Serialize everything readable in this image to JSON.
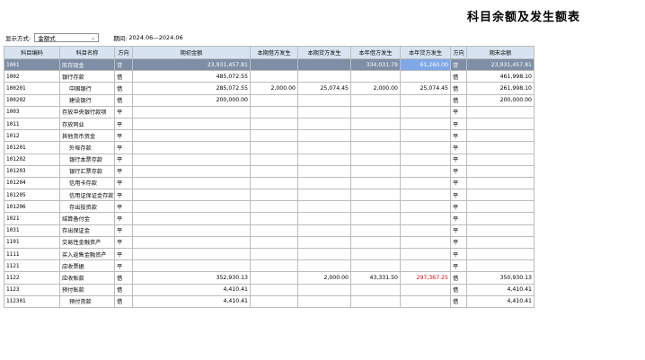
{
  "title": "科目余额及发生额表",
  "toolbar": {
    "display_mode_label": "显示方式:",
    "display_mode_value": "金额式",
    "period_label": "期间:",
    "period_value": "2024.06—2024.06"
  },
  "columns": [
    "科目编码",
    "科目名称",
    "方向",
    "期初金额",
    "本期借方发生",
    "本期贷方发生",
    "本年借方发生",
    "本年贷方发生",
    "方向",
    "期末余额"
  ],
  "rows": [
    {
      "code": "1001",
      "name": "库存现金",
      "indent": 0,
      "dir1": "贷",
      "opening": "23,931,457.81",
      "cur_debit": "",
      "cur_credit": "",
      "year_debit": "334,031.79",
      "year_credit": "61,260.00",
      "dir2": "贷",
      "closing": "23,931,457.81"
    },
    {
      "code": "1002",
      "name": "银行存款",
      "indent": 0,
      "dir1": "借",
      "opening": "485,072.55",
      "cur_debit": "",
      "cur_credit": "",
      "year_debit": "",
      "year_credit": "",
      "dir2": "借",
      "closing": "461,998.10"
    },
    {
      "code": "100201",
      "name": "中国银行",
      "indent": 1,
      "dir1": "借",
      "opening": "285,072.55",
      "cur_debit": "2,000.00",
      "cur_credit": "25,074.45",
      "year_debit": "2,000.00",
      "year_credit": "25,074.45",
      "dir2": "借",
      "closing": "261,998.10"
    },
    {
      "code": "100202",
      "name": "建设银行",
      "indent": 1,
      "dir1": "借",
      "opening": "200,000.00",
      "cur_debit": "",
      "cur_credit": "",
      "year_debit": "",
      "year_credit": "",
      "dir2": "借",
      "closing": "200,000.00"
    },
    {
      "code": "1003",
      "name": "存放中央银行款项",
      "indent": 0,
      "dir1": "平",
      "opening": "",
      "cur_debit": "",
      "cur_credit": "",
      "year_debit": "",
      "year_credit": "",
      "dir2": "平",
      "closing": ""
    },
    {
      "code": "1011",
      "name": "存放同业",
      "indent": 0,
      "dir1": "平",
      "opening": "",
      "cur_debit": "",
      "cur_credit": "",
      "year_debit": "",
      "year_credit": "",
      "dir2": "平",
      "closing": ""
    },
    {
      "code": "1012",
      "name": "其他货币资金",
      "indent": 0,
      "dir1": "平",
      "opening": "",
      "cur_debit": "",
      "cur_credit": "",
      "year_debit": "",
      "year_credit": "",
      "dir2": "平",
      "closing": ""
    },
    {
      "code": "101201",
      "name": "外埠存款",
      "indent": 1,
      "dir1": "平",
      "opening": "",
      "cur_debit": "",
      "cur_credit": "",
      "year_debit": "",
      "year_credit": "",
      "dir2": "平",
      "closing": ""
    },
    {
      "code": "101202",
      "name": "银行本票存款",
      "indent": 1,
      "dir1": "平",
      "opening": "",
      "cur_debit": "",
      "cur_credit": "",
      "year_debit": "",
      "year_credit": "",
      "dir2": "平",
      "closing": ""
    },
    {
      "code": "101203",
      "name": "银行汇票存款",
      "indent": 1,
      "dir1": "平",
      "opening": "",
      "cur_debit": "",
      "cur_credit": "",
      "year_debit": "",
      "year_credit": "",
      "dir2": "平",
      "closing": ""
    },
    {
      "code": "101204",
      "name": "信用卡存款",
      "indent": 1,
      "dir1": "平",
      "opening": "",
      "cur_debit": "",
      "cur_credit": "",
      "year_debit": "",
      "year_credit": "",
      "dir2": "平",
      "closing": ""
    },
    {
      "code": "101205",
      "name": "信用证保证金存款",
      "indent": 1,
      "dir1": "平",
      "opening": "",
      "cur_debit": "",
      "cur_credit": "",
      "year_debit": "",
      "year_credit": "",
      "dir2": "平",
      "closing": ""
    },
    {
      "code": "101206",
      "name": "存出投资款",
      "indent": 1,
      "dir1": "平",
      "opening": "",
      "cur_debit": "",
      "cur_credit": "",
      "year_debit": "",
      "year_credit": "",
      "dir2": "平",
      "closing": ""
    },
    {
      "code": "1021",
      "name": "结算备付金",
      "indent": 0,
      "dir1": "平",
      "opening": "",
      "cur_debit": "",
      "cur_credit": "",
      "year_debit": "",
      "year_credit": "",
      "dir2": "平",
      "closing": ""
    },
    {
      "code": "1031",
      "name": "存出保证金",
      "indent": 0,
      "dir1": "平",
      "opening": "",
      "cur_debit": "",
      "cur_credit": "",
      "year_debit": "",
      "year_credit": "",
      "dir2": "平",
      "closing": ""
    },
    {
      "code": "1101",
      "name": "交易性金融资产",
      "indent": 0,
      "dir1": "平",
      "opening": "",
      "cur_debit": "",
      "cur_credit": "",
      "year_debit": "",
      "year_credit": "",
      "dir2": "平",
      "closing": ""
    },
    {
      "code": "1111",
      "name": "买入返售金融资产",
      "indent": 0,
      "dir1": "平",
      "opening": "",
      "cur_debit": "",
      "cur_credit": "",
      "year_debit": "",
      "year_credit": "",
      "dir2": "平",
      "closing": ""
    },
    {
      "code": "1121",
      "name": "应收票据",
      "indent": 0,
      "dir1": "平",
      "opening": "",
      "cur_debit": "",
      "cur_credit": "",
      "year_debit": "",
      "year_credit": "",
      "dir2": "平",
      "closing": ""
    },
    {
      "code": "1122",
      "name": "应收账款",
      "indent": 0,
      "dir1": "借",
      "opening": "352,930.13",
      "cur_debit": "",
      "cur_credit": "2,000.00",
      "year_debit": "43,331.50",
      "year_credit": "297,367.25",
      "dir2": "借",
      "closing": "350,930.13"
    },
    {
      "code": "1123",
      "name": "预付账款",
      "indent": 0,
      "dir1": "借",
      "opening": "4,410.41",
      "cur_debit": "",
      "cur_credit": "",
      "year_debit": "",
      "year_credit": "",
      "dir2": "借",
      "closing": "4,410.41"
    },
    {
      "code": "112301",
      "name": "预付货款",
      "indent": 1,
      "dir1": "借",
      "opening": "4,410.41",
      "cur_debit": "",
      "cur_credit": "",
      "year_debit": "",
      "year_credit": "",
      "dir2": "借",
      "closing": "4,410.41"
    }
  ],
  "selected_row": 0,
  "highlight": {
    "selected_bg": "#7e8ea5",
    "selected_cell_bg": "#7fa8e8",
    "negative_text": "#e00000",
    "header_bg": "#d7e3f1"
  }
}
